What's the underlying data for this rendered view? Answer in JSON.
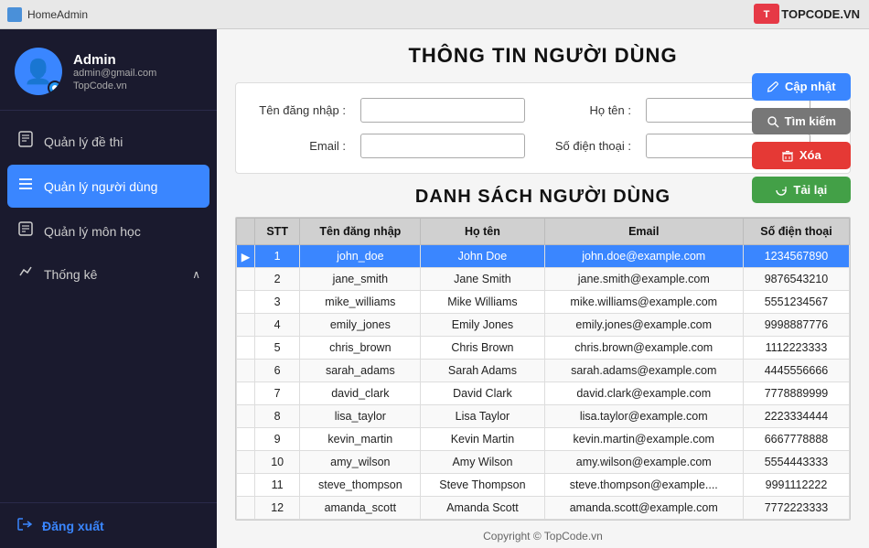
{
  "titlebar": {
    "app_name": "HomeAdmin",
    "logo_badge": "T",
    "logo_text": "TOPCODE.VN"
  },
  "sidebar": {
    "profile": {
      "name": "Admin",
      "email": "admin@gmail.com",
      "brand": "TopCode.vn"
    },
    "nav_items": [
      {
        "id": "de-thi",
        "label": "Quản lý đề thi",
        "icon": "📋",
        "active": false
      },
      {
        "id": "nguoi-dung",
        "label": "Quản lý người dùng",
        "icon": "☰",
        "active": true
      },
      {
        "id": "mon-hoc",
        "label": "Quản lý môn học",
        "icon": "📖",
        "active": false
      },
      {
        "id": "thong-ke",
        "label": "Thống kê",
        "icon": "∧",
        "active": false
      }
    ],
    "logout_label": "Đăng xuất"
  },
  "main": {
    "page_title": "THÔNG TIN NGƯỜI DÙNG",
    "form": {
      "ten_dang_nhap_label": "Tên đăng nhập :",
      "ho_ten_label": "Họ tên :",
      "email_label": "Email :",
      "so_dien_thoai_label": "Số điện thoại :",
      "ten_dang_nhap_value": "",
      "ho_ten_value": "",
      "email_value": "",
      "so_dien_thoai_value": ""
    },
    "buttons": {
      "cap_nhat": "Cập nhật",
      "tim_kiem": "Tìm kiếm",
      "xoa": "Xóa",
      "tai_lai": "Tải lại"
    },
    "table_title": "DANH SÁCH NGƯỜI DÙNG",
    "table": {
      "headers": [
        "STT",
        "Tên đăng nhập",
        "Họ tên",
        "Email",
        "Số điện thoại"
      ],
      "rows": [
        {
          "stt": 1,
          "username": "john_doe",
          "fullname": "John Doe",
          "email": "john.doe@example.com",
          "phone": "1234567890",
          "selected": true
        },
        {
          "stt": 2,
          "username": "jane_smith",
          "fullname": "Jane Smith",
          "email": "jane.smith@example.com",
          "phone": "9876543210",
          "selected": false
        },
        {
          "stt": 3,
          "username": "mike_williams",
          "fullname": "Mike Williams",
          "email": "mike.williams@example.com",
          "phone": "5551234567",
          "selected": false
        },
        {
          "stt": 4,
          "username": "emily_jones",
          "fullname": "Emily Jones",
          "email": "emily.jones@example.com",
          "phone": "9998887776",
          "selected": false
        },
        {
          "stt": 5,
          "username": "chris_brown",
          "fullname": "Chris Brown",
          "email": "chris.brown@example.com",
          "phone": "1112223333",
          "selected": false
        },
        {
          "stt": 6,
          "username": "sarah_adams",
          "fullname": "Sarah Adams",
          "email": "sarah.adams@example.com",
          "phone": "4445556666",
          "selected": false
        },
        {
          "stt": 7,
          "username": "david_clark",
          "fullname": "David Clark",
          "email": "david.clark@example.com",
          "phone": "7778889999",
          "selected": false
        },
        {
          "stt": 8,
          "username": "lisa_taylor",
          "fullname": "Lisa Taylor",
          "email": "lisa.taylor@example.com",
          "phone": "2223334444",
          "selected": false
        },
        {
          "stt": 9,
          "username": "kevin_martin",
          "fullname": "Kevin Martin",
          "email": "kevin.martin@example.com",
          "phone": "6667778888",
          "selected": false
        },
        {
          "stt": 10,
          "username": "amy_wilson",
          "fullname": "Amy Wilson",
          "email": "amy.wilson@example.com",
          "phone": "5554443333",
          "selected": false
        },
        {
          "stt": 11,
          "username": "steve_thompson",
          "fullname": "Steve Thompson",
          "email": "steve.thompson@example....",
          "phone": "9991112222",
          "selected": false
        },
        {
          "stt": 12,
          "username": "amanda_scott",
          "fullname": "Amanda Scott",
          "email": "amanda.scott@example.com",
          "phone": "7772223333",
          "selected": false
        }
      ]
    },
    "copyright": "Copyright © TopCode.vn"
  }
}
